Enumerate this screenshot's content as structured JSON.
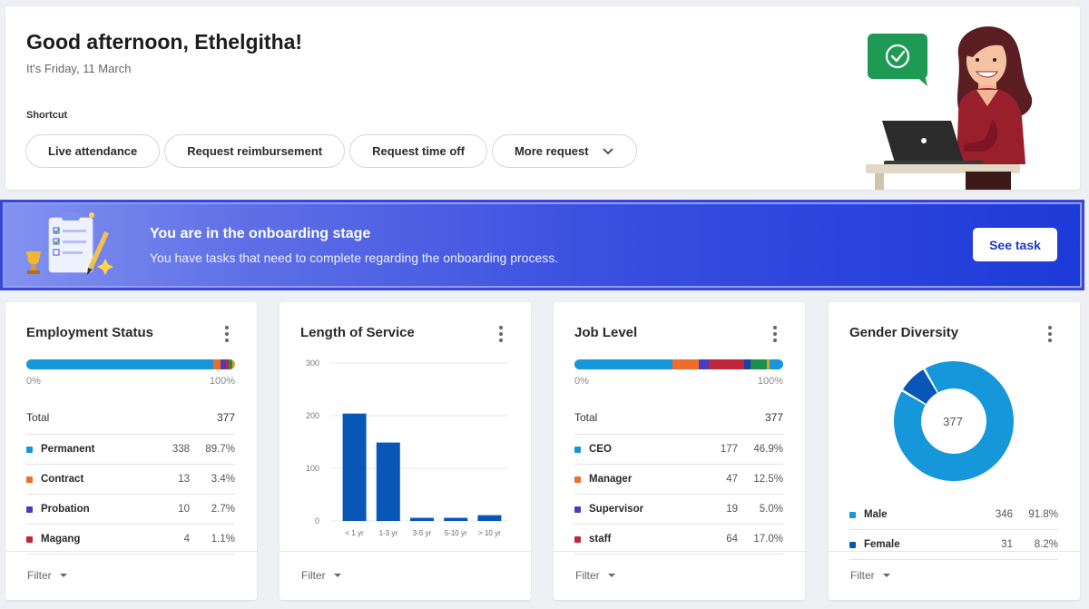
{
  "greeting": {
    "title": "Good afternoon, Ethelgitha!",
    "date": "It's Friday, 11 March",
    "shortcut_label": "Shortcut",
    "shortcuts": [
      "Live attendance",
      "Request reimbursement",
      "Request time off",
      "More request"
    ]
  },
  "banner": {
    "title": "You are in the onboarding stage",
    "subtitle": "You have tasks that need to complete regarding the onboarding process.",
    "button": "See task"
  },
  "filter_label": "Filter",
  "employment_status": {
    "title": "Employment Status",
    "scale_min": "0%",
    "scale_max": "100%",
    "total_label": "Total",
    "total": "377",
    "rows": [
      {
        "name": "Permanent",
        "count": "338",
        "pct": "89.7%",
        "color": "#1597d9",
        "share": 89.7
      },
      {
        "name": "Contract",
        "count": "13",
        "pct": "3.4%",
        "color": "#ef6c2a",
        "share": 3.4
      },
      {
        "name": "Probation",
        "count": "10",
        "pct": "2.7%",
        "color": "#4a3bc4",
        "share": 2.7
      },
      {
        "name": "Magang",
        "count": "4",
        "pct": "1.1%",
        "color": "#c0263a",
        "share": 1.1
      }
    ],
    "extra_segments": [
      {
        "color": "#1b8f4a",
        "share": 1.6
      },
      {
        "color": "#e0a020",
        "share": 1.5
      }
    ]
  },
  "length_of_service": {
    "title": "Length of Service",
    "chart_data": {
      "type": "bar",
      "categories": [
        "< 1 yr",
        "1-3 yr",
        "3-5 yr",
        "5-10 yr",
        "> 10 yr"
      ],
      "values": [
        204,
        149,
        6,
        6,
        11
      ],
      "yticks": [
        "0",
        "100",
        "200",
        "300"
      ],
      "ylim": [
        0,
        300
      ],
      "color": "#0857b8"
    }
  },
  "job_level": {
    "title": "Job Level",
    "scale_min": "0%",
    "scale_max": "100%",
    "total_label": "Total",
    "total": "377",
    "rows": [
      {
        "name": "CEO",
        "count": "177",
        "pct": "46.9%",
        "color": "#1597d9",
        "share": 46.9
      },
      {
        "name": "Manager",
        "count": "47",
        "pct": "12.5%",
        "color": "#ef6c2a",
        "share": 12.5
      },
      {
        "name": "Supervisor",
        "count": "19",
        "pct": "5.0%",
        "color": "#4a3bc4",
        "share": 5.0
      },
      {
        "name": "staff",
        "count": "64",
        "pct": "17.0%",
        "color": "#c0263a",
        "share": 17.0
      }
    ],
    "extra_segments": [
      {
        "color": "#1b3fa8",
        "share": 3.0
      },
      {
        "color": "#1b8f4a",
        "share": 8.0
      },
      {
        "color": "#e0a020",
        "share": 1.0
      },
      {
        "color": "#1597d9",
        "share": 6.6
      }
    ]
  },
  "gender_diversity": {
    "title": "Gender Diversity",
    "total": "377",
    "chart_data": {
      "type": "pie",
      "labels": [
        "Male",
        "Female"
      ],
      "values": [
        346,
        31
      ],
      "colors": [
        "#1597d9",
        "#0857b8"
      ]
    },
    "rows": [
      {
        "name": "Male",
        "count": "346",
        "pct": "91.8%",
        "color": "#1597d9"
      },
      {
        "name": "Female",
        "count": "31",
        "pct": "8.2%",
        "color": "#0857b8"
      }
    ]
  }
}
